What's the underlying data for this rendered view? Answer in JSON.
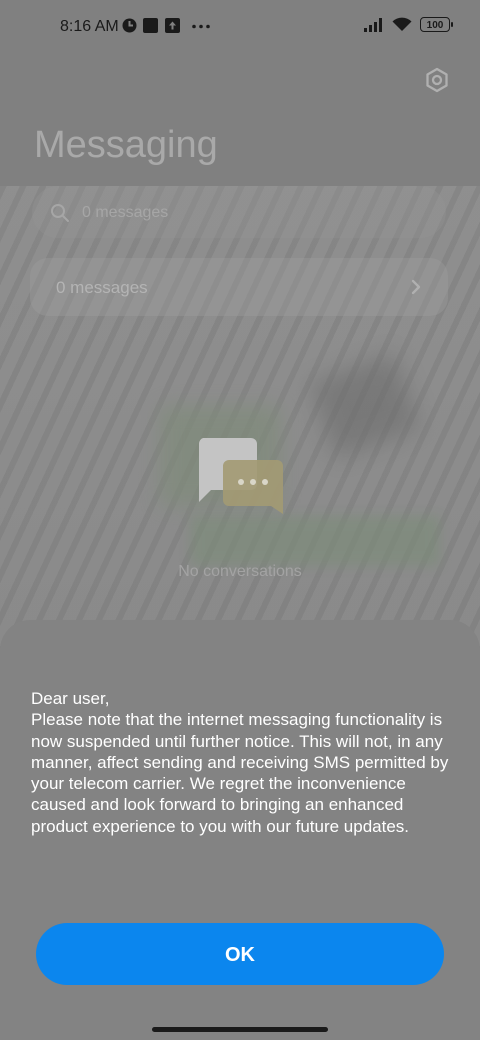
{
  "status_bar": {
    "time": "8:16 AM",
    "battery": "100",
    "icons": [
      "settings-circle-icon",
      "square-icon",
      "upload-icon",
      "more-dots-icon",
      "signal-icon",
      "wifi-icon",
      "battery-icon"
    ]
  },
  "header": {
    "title": "Messaging",
    "settings_icon": "gear-icon"
  },
  "search": {
    "placeholder": "0 messages"
  },
  "messages_row": {
    "label": "0 messages"
  },
  "empty_state": {
    "text": "No conversations",
    "icon": "chat-bubbles-icon"
  },
  "dialog": {
    "message": "Dear user,\nPlease note that the internet messaging functionality is now suspended until further notice. This will not, in any manner, affect sending and receiving SMS permitted by your telecom carrier. We regret the inconvenience caused and look forward to bringing an enhanced product experience to you with our future updates.",
    "ok_label": "OK"
  },
  "colors": {
    "accent": "#0b86ee",
    "overlay": "#808080"
  }
}
